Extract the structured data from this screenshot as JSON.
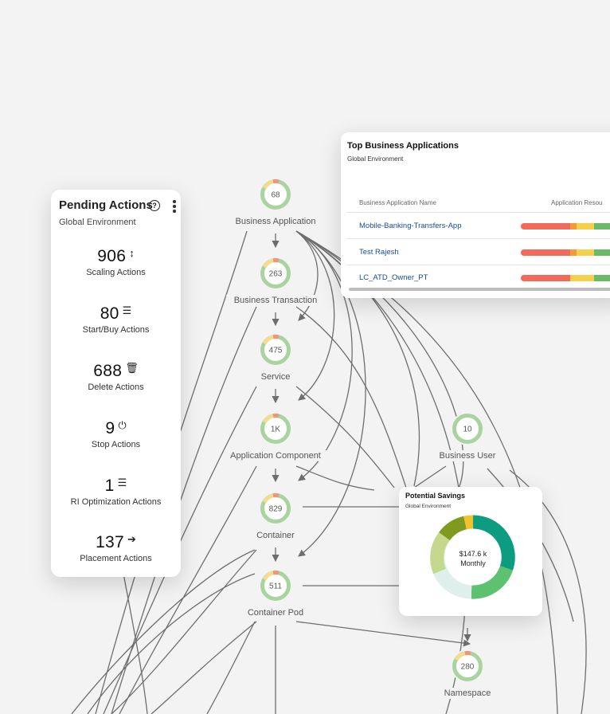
{
  "graph": {
    "nodes": [
      {
        "id": "business_application",
        "label": "Business Application",
        "count": "68"
      },
      {
        "id": "business_transaction",
        "label": "Business Transaction",
        "count": "263"
      },
      {
        "id": "service",
        "label": "Service",
        "count": "475"
      },
      {
        "id": "application_component",
        "label": "Application Component",
        "count": "1K"
      },
      {
        "id": "container",
        "label": "Container",
        "count": "829"
      },
      {
        "id": "container_pod",
        "label": "Container Pod",
        "count": "511"
      },
      {
        "id": "business_user",
        "label": "Business User",
        "count": "10"
      },
      {
        "id": "namespace",
        "label": "Namespace",
        "count": "280"
      }
    ],
    "colors": {
      "ring_green": "#a9d4a0",
      "ring_yellow": "#f3dc8e",
      "ring_red": "#f0957a",
      "edge": "#6e6e6e"
    }
  },
  "pending_actions": {
    "title": "Pending Actions",
    "help_icon": "question-circle-icon",
    "menu_icon": "kebab-menu-icon",
    "scope": "Global Environment",
    "actions": [
      {
        "count": "906",
        "label": "Scaling Actions",
        "icon": "scaling-arrows-icon",
        "glyph": "↕"
      },
      {
        "count": "80",
        "label": "Start/Buy Actions",
        "icon": "server-stack-icon",
        "glyph": "☰"
      },
      {
        "count": "688",
        "label": "Delete Actions",
        "icon": "trash-icon",
        "glyph": "🗑"
      },
      {
        "count": "9",
        "label": "Stop Actions",
        "icon": "power-icon",
        "glyph": "⏻"
      },
      {
        "count": "1",
        "label": "RI Optimization Actions",
        "icon": "server-stack-icon",
        "glyph": "☰"
      },
      {
        "count": "137",
        "label": "Placement Actions",
        "icon": "arrow-right-icon",
        "glyph": "➔"
      }
    ]
  },
  "top_business_applications": {
    "title": "Top Business Applications",
    "scope": "Global Environment",
    "columns": [
      "Business Application Name",
      "Application Resou"
    ],
    "rows": [
      {
        "name": "Mobile-Banking-Transfers-App"
      },
      {
        "name": "Test Rajesh"
      },
      {
        "name": "LC_ATD_Owner_PT"
      }
    ],
    "bar_colors": {
      "red": "#f26a5a",
      "orange": "#f39a3b",
      "yellow": "#f6d04d",
      "green": "#6bba6a"
    }
  },
  "potential_savings": {
    "title": "Potential Savings",
    "scope": "Global Environment",
    "amount": "$147.6 k",
    "period": "Monthly",
    "segment_colors": [
      "#0e9c80",
      "#5cc26f",
      "#dff0ec",
      "#c4d98d",
      "#7f9a1f",
      "#f2c22e"
    ]
  }
}
